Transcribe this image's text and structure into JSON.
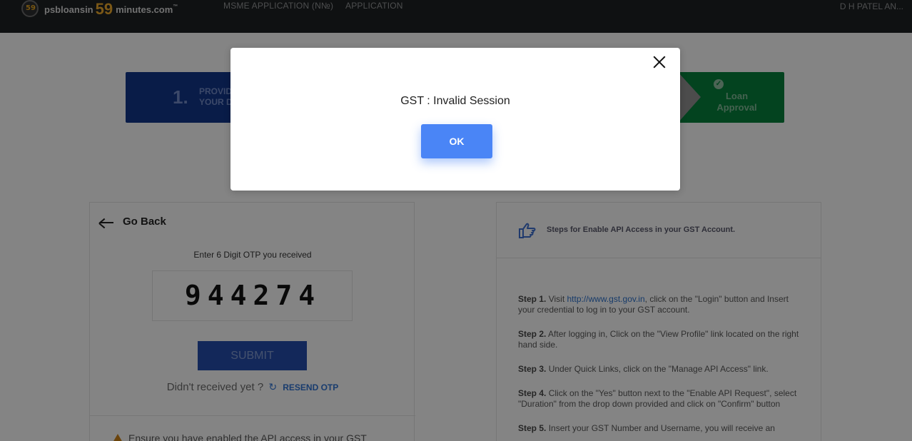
{
  "header": {
    "logo_text_1": "psbloansin",
    "logo_number": "59",
    "logo_text_2": "minutes.com",
    "logo_tm": "™",
    "emblem_number": "59",
    "nav": [
      "MSME APPLICATION (N№)",
      "APPLICATION"
    ],
    "user": "D H PATEL AN..."
  },
  "progress": {
    "step1_number": "1.",
    "step1_text": "PROVID\nYOUR DA",
    "step1_line1": "PROVID",
    "step1_line2": "YOUR DA",
    "step3_line1": "Loan",
    "step3_line2": "Approval",
    "step3_color": "#067a3a",
    "step1_color": "#123384"
  },
  "otp_card": {
    "go_back": "Go Back",
    "label": "Enter 6 Digit OTP you received",
    "otp_value": "944274",
    "submit": "SUBMIT",
    "didnt_receive": "Didn't received yet ?",
    "resend": "RESEND OTP",
    "warning": "Ensure you have enabled the API access in your GST"
  },
  "guide_card": {
    "title": "Steps for Enable API Access in your GST Account.",
    "steps": [
      {
        "label": "Step 1.",
        "pre": " Visit ",
        "link": "http://www.gst.gov.in",
        "post": ", click on the \"Login\" button and Insert your credential to log in to your GST account."
      },
      {
        "label": "Step 2.",
        "text": " After logging in, Click on the \"View Profile\" link located on the right hand side."
      },
      {
        "label": "Step 3.",
        "text": " Under Quick Links, click on the \"Manage API Access\" link."
      },
      {
        "label": "Step 4.",
        "text": " Click on the \"Yes\" button next to the \"Enable API Request\", select \"Duration\" from the drop down provided and click on \"Confirm\" button"
      },
      {
        "label": "Step 5.",
        "text": " Insert your GST Number and Username, you will receive an"
      }
    ]
  },
  "modal": {
    "message": "GST : Invalid Session",
    "ok": "OK",
    "accent": "#4a85f6"
  }
}
